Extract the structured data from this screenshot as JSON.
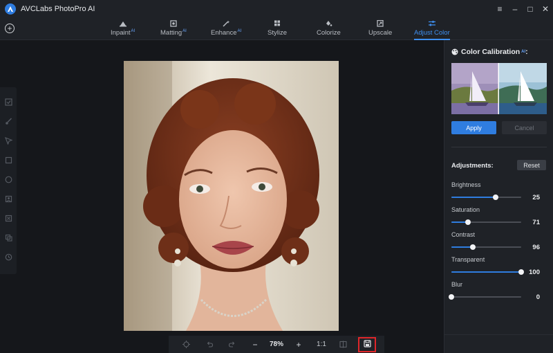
{
  "app": {
    "title": "AVCLabs PhotoPro AI"
  },
  "window_controls": {
    "menu": "≡",
    "minimize": "–",
    "maximize": "□",
    "close": "✕"
  },
  "toolbar": {
    "add": "+",
    "tabs": [
      {
        "label": "Inpaint",
        "ai": "AI",
        "icon": "inpaint-icon",
        "active": false
      },
      {
        "label": "Matting",
        "ai": "AI",
        "icon": "matting-icon",
        "active": false
      },
      {
        "label": "Enhance",
        "ai": "AI",
        "icon": "enhance-icon",
        "active": false
      },
      {
        "label": "Stylize",
        "ai": "",
        "icon": "stylize-icon",
        "active": false
      },
      {
        "label": "Colorize",
        "ai": "",
        "icon": "colorize-icon",
        "active": false
      },
      {
        "label": "Upscale",
        "ai": "",
        "icon": "upscale-icon",
        "active": false
      },
      {
        "label": "Adjust Color",
        "ai": "",
        "icon": "sliders-icon",
        "active": true
      }
    ]
  },
  "left_tools": [
    "select-icon",
    "brush-icon",
    "lasso-icon",
    "rectangle-icon",
    "ellipse-icon",
    "face-icon",
    "image-select-icon",
    "layers-icon",
    "history-icon"
  ],
  "bottom_bar": {
    "zoom_out": "−",
    "zoom": "78%",
    "zoom_in": "+",
    "actual_size": "1:1"
  },
  "panel": {
    "title": "Color Calibration",
    "title_ai": "AI",
    "title_suffix": ":",
    "apply": "Apply",
    "cancel": "Cancel",
    "adjustments_label": "Adjustments:",
    "reset": "Reset",
    "sliders": [
      {
        "label": "Brightness",
        "value": 25,
        "fraction": 0.63
      },
      {
        "label": "Saturation",
        "value": 71,
        "fraction": 0.24
      },
      {
        "label": "Contrast",
        "value": 96,
        "fraction": 0.31
      },
      {
        "label": "Transparent",
        "value": 100,
        "fraction": 1.0
      },
      {
        "label": "Blur",
        "value": 0,
        "fraction": 0.0
      }
    ]
  },
  "colors": {
    "accent": "#2f7de0",
    "highlight_box": "#e0262a",
    "background": "#16181c"
  }
}
